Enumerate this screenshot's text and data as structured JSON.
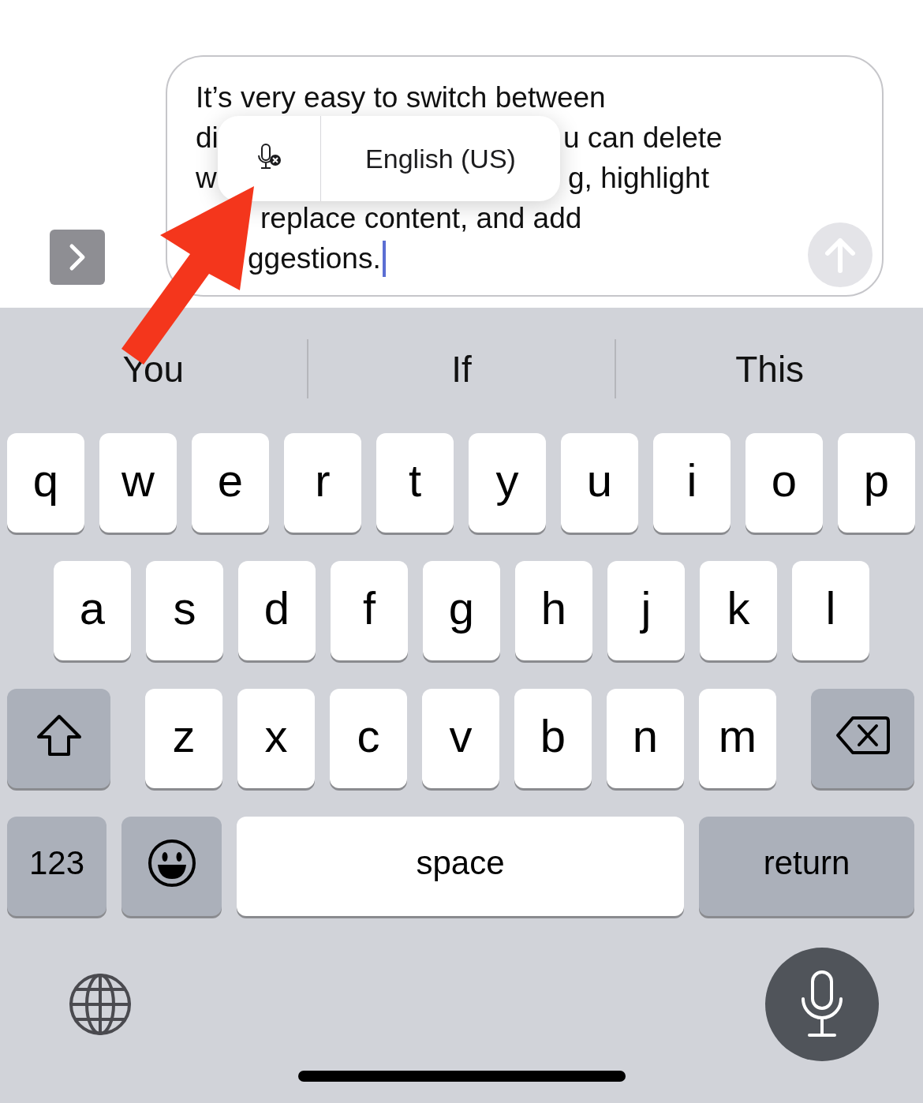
{
  "composer": {
    "text_lines": [
      [
        "It’s very easy to switch between"
      ],
      [
        "di",
        "u can delete"
      ],
      [
        "w",
        "g, highlight"
      ],
      [
        "replace content, and add"
      ],
      [
        "ggestions."
      ]
    ],
    "dictation_popup": {
      "language": "English (US)"
    }
  },
  "suggestions": [
    {
      "label": "You"
    },
    {
      "label": "If"
    },
    {
      "label": "This"
    }
  ],
  "keyboard": {
    "rows": [
      {
        "keys": [
          {
            "kind": "letter",
            "label": "q"
          },
          {
            "kind": "letter",
            "label": "w"
          },
          {
            "kind": "letter",
            "label": "e"
          },
          {
            "kind": "letter",
            "label": "r"
          },
          {
            "kind": "letter",
            "label": "t"
          },
          {
            "kind": "letter",
            "label": "y"
          },
          {
            "kind": "letter",
            "label": "u"
          },
          {
            "kind": "letter",
            "label": "i"
          },
          {
            "kind": "letter",
            "label": "o"
          },
          {
            "kind": "letter",
            "label": "p"
          }
        ]
      },
      {
        "keys": [
          {
            "kind": "letter",
            "label": "a"
          },
          {
            "kind": "letter",
            "label": "s"
          },
          {
            "kind": "letter",
            "label": "d"
          },
          {
            "kind": "letter",
            "label": "f"
          },
          {
            "kind": "letter",
            "label": "g"
          },
          {
            "kind": "letter",
            "label": "h"
          },
          {
            "kind": "letter",
            "label": "j"
          },
          {
            "kind": "letter",
            "label": "k"
          },
          {
            "kind": "letter",
            "label": "l"
          }
        ]
      },
      {
        "keys": [
          {
            "kind": "shift"
          },
          {
            "kind": "letter",
            "label": "z"
          },
          {
            "kind": "letter",
            "label": "x"
          },
          {
            "kind": "letter",
            "label": "c"
          },
          {
            "kind": "letter",
            "label": "v"
          },
          {
            "kind": "letter",
            "label": "b"
          },
          {
            "kind": "letter",
            "label": "n"
          },
          {
            "kind": "letter",
            "label": "m"
          },
          {
            "kind": "delete"
          }
        ]
      },
      {
        "keys": [
          {
            "kind": "numbers",
            "label": "123"
          },
          {
            "kind": "emoji"
          },
          {
            "kind": "space",
            "label": "space"
          },
          {
            "kind": "return",
            "label": "return"
          }
        ]
      }
    ]
  }
}
